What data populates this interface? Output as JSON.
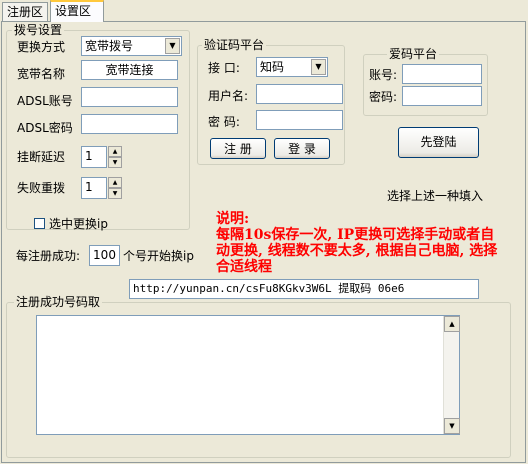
{
  "tabs": [
    {
      "label": "注册区"
    },
    {
      "label": "设置区"
    }
  ],
  "dial": {
    "group_title": "拨号设置",
    "method_label": "更换方式",
    "method_value": "宽带拨号",
    "broadband_label": "宽带名称",
    "broadband_value": "宽带连接",
    "adsl_account_label": "ADSL账号",
    "adsl_account_value": "",
    "adsl_password_label": "ADSL密码",
    "adsl_password_value": "",
    "hangup_delay_label": "挂断延迟",
    "hangup_delay_value": "1",
    "fail_redial_label": "失败重拨",
    "fail_redial_value": "1",
    "change_ip_label": "选中更换ip",
    "change_ip_checked": false,
    "every_success_label": "每注册成功:",
    "every_success_value": "100",
    "every_success_suffix": "个号开始换ip"
  },
  "captcha": {
    "group_title": "验证码平台",
    "interface_label": "接  口:",
    "interface_value": "知码",
    "username_label": "用户名:",
    "username_value": "",
    "password_label": "密  码:",
    "password_value": "",
    "register_button": "注 册",
    "login_button": "登 录"
  },
  "aima": {
    "group_title": "爱码平台",
    "account_label": "账号:",
    "account_value": "",
    "password_label": "密码:",
    "password_value": "",
    "login_first_button": "先登陆",
    "hint": "选择上述一种填入"
  },
  "note": {
    "title": "说明:",
    "body": "每隔10s保存一次, IP更换可选择手动或者自动更换, 线程数不要太多, 根据自己电脑, 选择合适线程"
  },
  "link": {
    "value": "http://yunpan.cn/csFu8KGkv3W6L  提取码 06e6"
  },
  "success_numbers": {
    "group_title": "注册成功号码取",
    "content": ""
  },
  "colors": {
    "window_bg": "#ece9d8",
    "note_text": "#ff0000",
    "active_tab_highlight": "#ffc83c"
  }
}
